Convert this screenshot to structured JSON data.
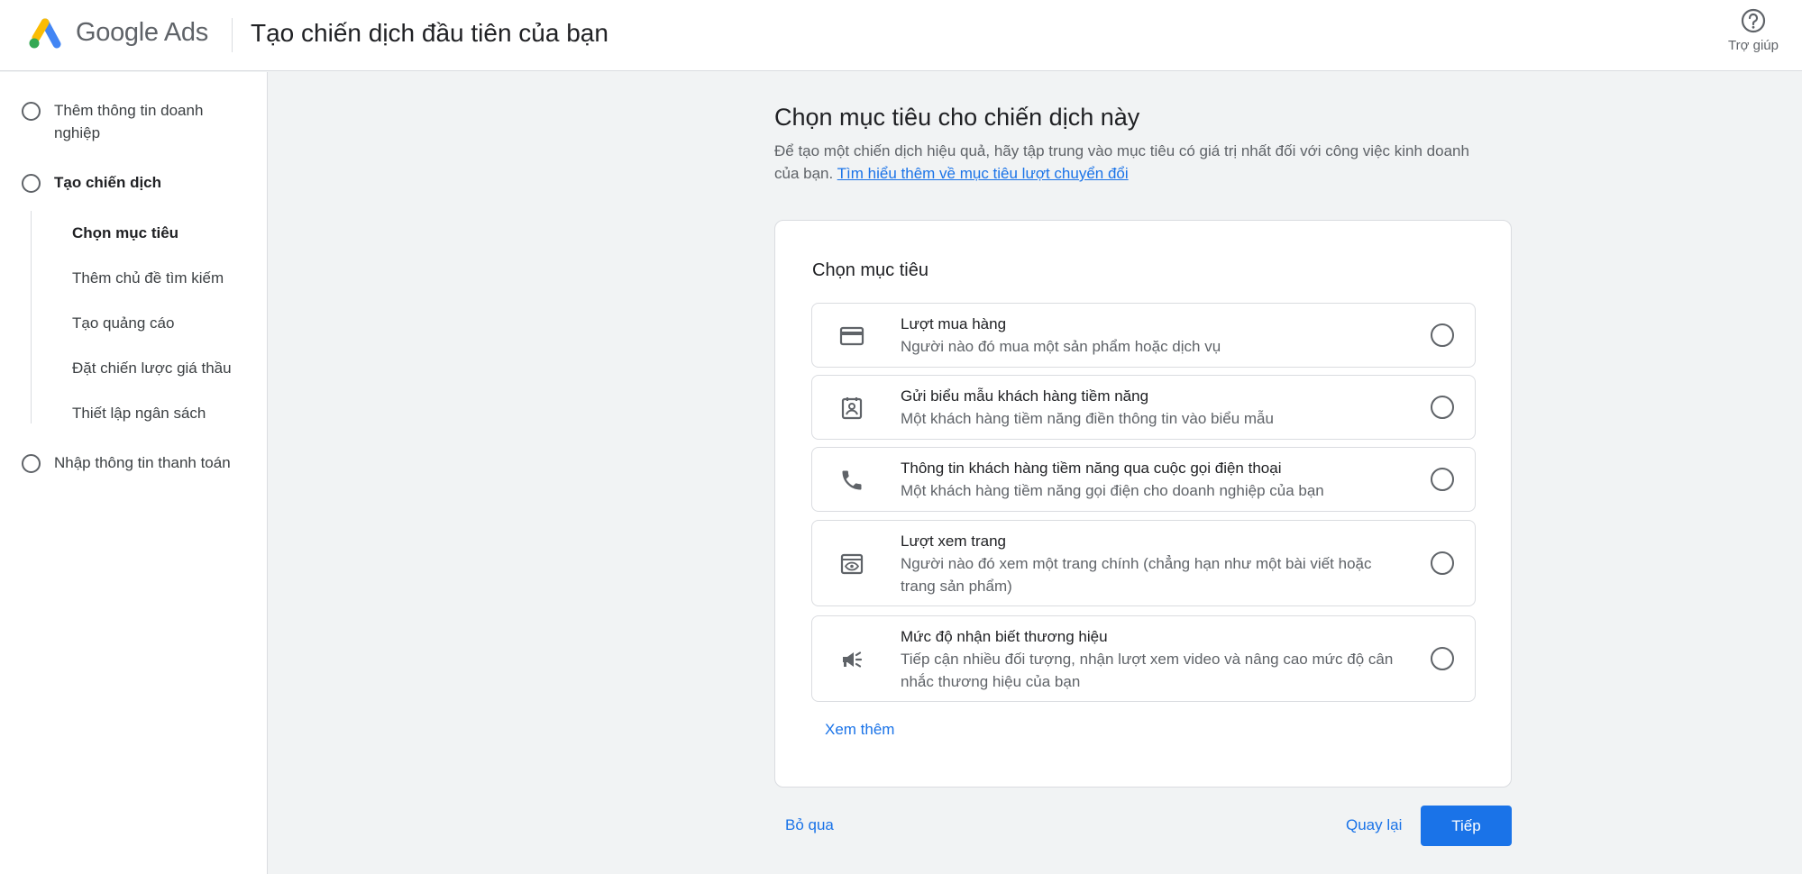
{
  "header": {
    "brand": "Google Ads",
    "title": "Tạo chiến dịch đầu tiên của bạn",
    "help_label": "Trợ giúp"
  },
  "sidebar": {
    "steps": [
      {
        "label": "Thêm thông tin doanh nghiệp"
      },
      {
        "label": "Tạo chiến dịch"
      },
      {
        "label": "Nhập thông tin thanh toán"
      }
    ],
    "substeps": [
      {
        "label": "Chọn mục tiêu"
      },
      {
        "label": "Thêm chủ đề tìm kiếm"
      },
      {
        "label": "Tạo quảng cáo"
      },
      {
        "label": "Đặt chiến lược giá thầu"
      },
      {
        "label": "Thiết lập ngân sách"
      }
    ]
  },
  "main": {
    "title": "Chọn mục tiêu cho chiến dịch này",
    "description": "Để tạo một chiến dịch hiệu quả, hãy tập trung vào mục tiêu có giá trị nhất đối với công việc kinh doanh của bạn.",
    "learn_more_link": "Tìm hiểu thêm về mục tiêu lượt chuyển đổi"
  },
  "card": {
    "title": "Chọn mục tiêu",
    "options": [
      {
        "icon": "credit-card-icon",
        "title": "Lượt mua hàng",
        "description": "Người nào đó mua một sản phẩm hoặc dịch vụ"
      },
      {
        "icon": "contact-form-icon",
        "title": "Gửi biểu mẫu khách hàng tiềm năng",
        "description": "Một khách hàng tiềm năng điền thông tin vào biểu mẫu"
      },
      {
        "icon": "phone-icon",
        "title": "Thông tin khách hàng tiềm năng qua cuộc gọi điện thoại",
        "description": "Một khách hàng tiềm năng gọi điện cho doanh nghiệp của bạn"
      },
      {
        "icon": "page-view-icon",
        "title": "Lượt xem trang",
        "description": "Người nào đó xem một trang chính (chẳng hạn như một bài viết hoặc trang sản phẩm)"
      },
      {
        "icon": "megaphone-icon",
        "title": "Mức độ nhận biết thương hiệu",
        "description": "Tiếp cận nhiều đối tượng, nhận lượt xem video và nâng cao mức độ cân nhắc thương hiệu của bạn"
      }
    ],
    "see_more": "Xem thêm"
  },
  "footer": {
    "skip": "Bỏ qua",
    "back": "Quay lại",
    "next": "Tiếp"
  },
  "colors": {
    "accent": "#1a73e8",
    "background": "#f1f3f4"
  }
}
